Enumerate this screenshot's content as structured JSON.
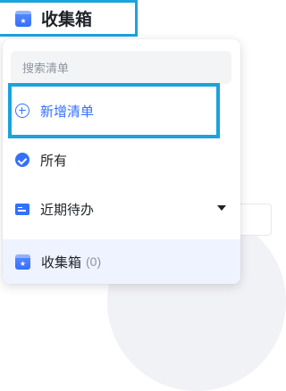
{
  "colors": {
    "accent": "#3370ff",
    "highlight_border": "#1aa3dc",
    "selected_row_bg": "#eef3ff"
  },
  "header": {
    "title": "收集箱",
    "icon": "inbox-icon"
  },
  "dropdown": {
    "search_placeholder": "搜索清单",
    "add_list_label": "新增清单",
    "items": [
      {
        "label": "所有",
        "icon": "check-circle-icon"
      },
      {
        "label": "近期待办",
        "icon": "list-icon",
        "expandable": true
      },
      {
        "label": "收集箱",
        "icon": "inbox-icon",
        "count": "(0)",
        "selected": true
      }
    ]
  }
}
